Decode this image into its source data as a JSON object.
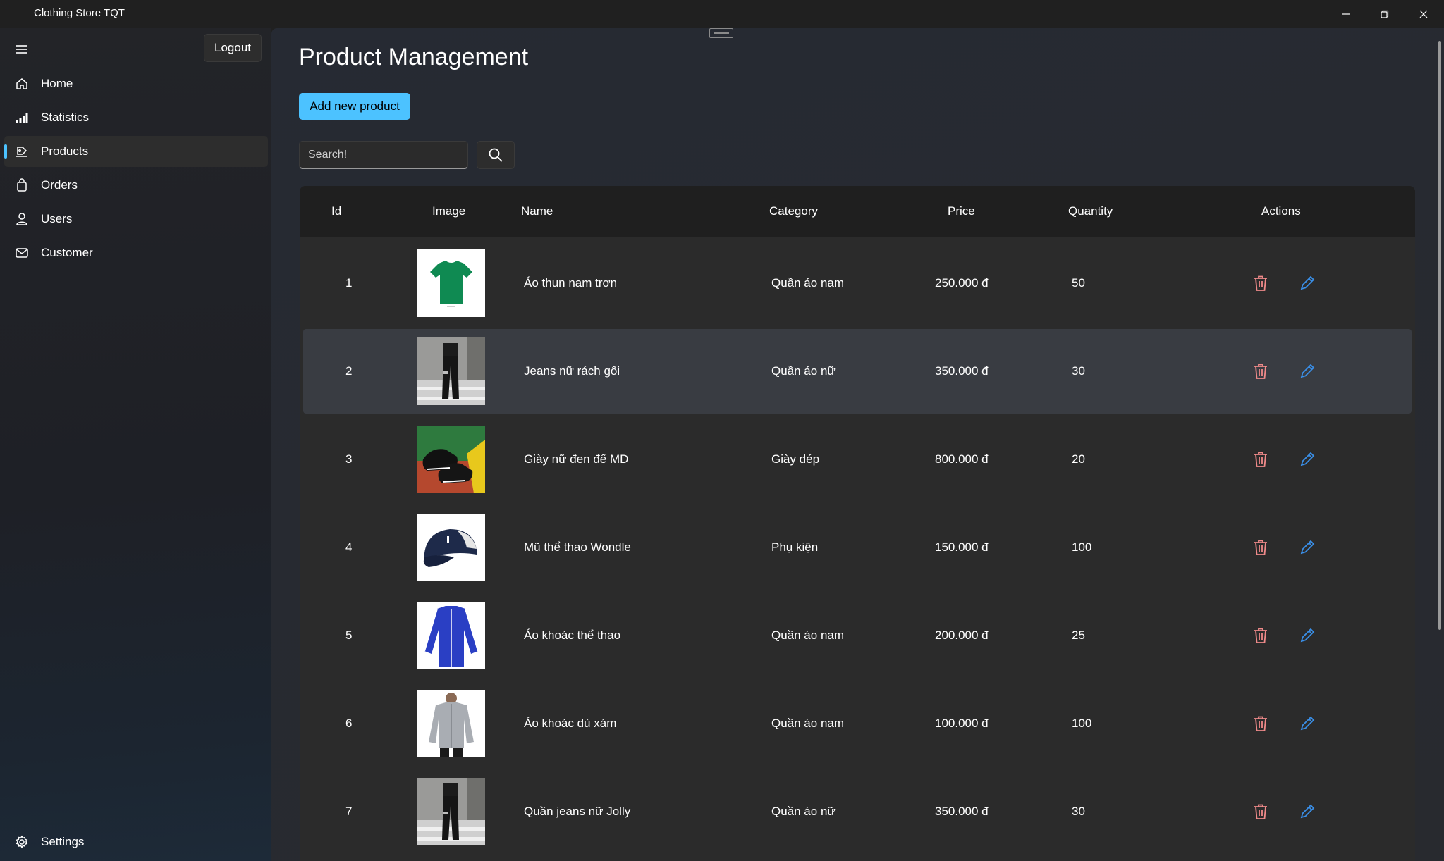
{
  "window": {
    "title": "Clothing Store TQT"
  },
  "sidebar": {
    "logout_label": "Logout",
    "items": [
      {
        "label": "Home",
        "icon": "home-icon"
      },
      {
        "label": "Statistics",
        "icon": "chart-icon"
      },
      {
        "label": "Products",
        "icon": "products-icon",
        "active": true
      },
      {
        "label": "Orders",
        "icon": "shopping-bag-icon"
      },
      {
        "label": "Users",
        "icon": "user-icon"
      },
      {
        "label": "Customer",
        "icon": "mail-icon"
      }
    ],
    "settings_label": "Settings"
  },
  "main": {
    "title": "Product Management",
    "add_button": "Add new product",
    "search_placeholder": "Search!",
    "columns": [
      "Id",
      "Image",
      "Name",
      "Category",
      "Price",
      "Quantity",
      "Actions"
    ],
    "rows": [
      {
        "id": "1",
        "image": "green-tshirt",
        "name": "Áo thun nam trơn",
        "category": "Quần áo nam",
        "price": "250.000 đ",
        "quantity": "50"
      },
      {
        "id": "2",
        "image": "ripped-jeans",
        "name": "Jeans nữ rách gối",
        "category": "Quần áo nữ",
        "price": "350.000 đ",
        "quantity": "30"
      },
      {
        "id": "3",
        "image": "black-sneakers",
        "name": "Giày nữ đen đế MD",
        "category": "Giày dép",
        "price": "800.000 đ",
        "quantity": "20"
      },
      {
        "id": "4",
        "image": "navy-cap",
        "name": "Mũ thể thao Wondle",
        "category": "Phụ kiện",
        "price": "150.000 đ",
        "quantity": "100"
      },
      {
        "id": "5",
        "image": "blue-track-jacket",
        "name": "Áo khoác thể thao",
        "category": "Quần áo nam",
        "price": "200.000 đ",
        "quantity": "25"
      },
      {
        "id": "6",
        "image": "grey-windbreaker",
        "name": "Áo khoác dù xám",
        "category": "Quần áo nam",
        "price": "100.000 đ",
        "quantity": "100"
      },
      {
        "id": "7",
        "image": "ripped-jeans",
        "name": "Quần jeans nữ Jolly",
        "category": "Quần áo nữ",
        "price": "350.000 đ",
        "quantity": "30"
      }
    ]
  },
  "colors": {
    "accent": "#4cc2ff",
    "delete": "#f08a8a",
    "edit": "#3a8fe8"
  }
}
